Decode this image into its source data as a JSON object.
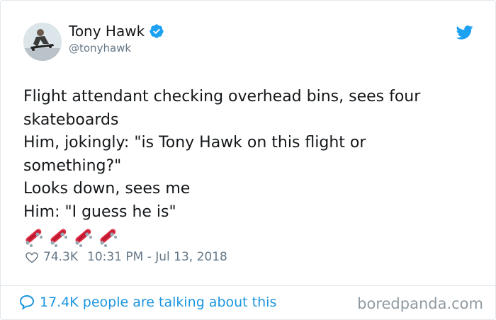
{
  "author": {
    "name": "Tony Hawk",
    "handle": "@tonyhawk",
    "verified": true
  },
  "tweet": {
    "lines": [
      "Flight attendant checking overhead bins, sees four",
      "skateboards",
      "Him, jokingly: \"is Tony Hawk on this flight or",
      "something?\"",
      "Looks down, sees me",
      "Him: \"I guess he is\""
    ],
    "emoji": [
      "skateboard-icon",
      "skateboard-icon",
      "skateboard-icon",
      "skateboard-icon"
    ]
  },
  "meta": {
    "likes": "74.3K",
    "timestamp": "10:31 PM - Jul 13, 2018"
  },
  "footer": {
    "talking": "17.4K people are talking about this",
    "watermark": "boredpanda.com"
  },
  "colors": {
    "twitter_blue": "#1da1f2",
    "link_blue": "#1b95e0",
    "text": "#14171a",
    "muted": "#657786"
  }
}
